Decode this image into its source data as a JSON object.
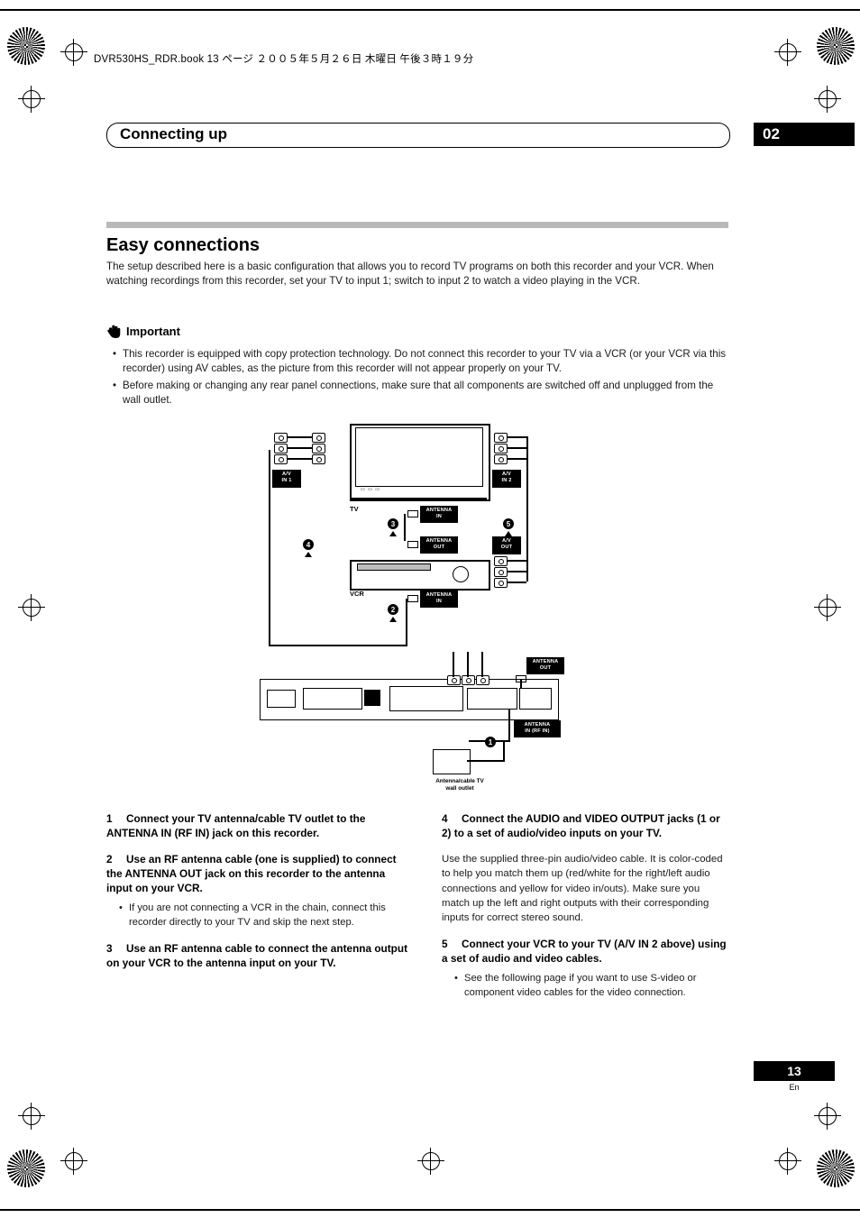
{
  "header": {
    "book_line": "DVR530HS_RDR.book  13 ページ  ２００５年５月２６日   木曜日   午後３時１９分",
    "chapter_title": "Connecting up",
    "chapter_number": "02"
  },
  "section": {
    "title": "Easy connections",
    "intro": "The setup described here is a basic configuration that allows you to record TV programs on both this recorder and your VCR. When watching recordings from this recorder, set your TV to input 1; switch to input 2 to watch a video playing in the VCR.",
    "important_label": "Important",
    "important_bullets": [
      "This recorder is equipped with copy protection technology. Do not connect this recorder to your TV via a VCR (or your VCR via this recorder) using AV cables, as the picture from this recorder will not appear properly on your TV.",
      "Before making or changing any rear panel connections, make sure that all components are switched off and unplugged from the wall outlet."
    ]
  },
  "diagram": {
    "tv_label": "TV",
    "vcr_label": "VCR",
    "av_in_1": "A/V\nIN 1",
    "av_in_2": "A/V\nIN 2",
    "av_out": "A/V\nOUT",
    "antenna_in_tv": "ANTENNA\nIN",
    "antenna_out_tv": "ANTENNA\nOUT",
    "antenna_in_vcr": "ANTENNA\nIN",
    "antenna_out_recorder": "ANTENNA\nOUT",
    "antenna_in_rf": "ANTENNA\nIN (RF IN)",
    "wall_outlet": "Antenna/cable TV\nwall outlet",
    "callouts": [
      "1",
      "2",
      "3",
      "4",
      "5"
    ]
  },
  "steps": {
    "left": [
      {
        "num": "1",
        "title": "Connect your TV antenna/cable TV outlet to the ANTENNA IN (RF IN) jack on this recorder."
      },
      {
        "num": "2",
        "title": "Use an RF antenna cable (one is supplied) to connect the ANTENNA OUT jack on this recorder to the antenna input on your VCR.",
        "bullet": "If you are not connecting a VCR in the chain, connect this recorder directly to your TV and skip the next step."
      },
      {
        "num": "3",
        "title": "Use an RF antenna cable to connect the antenna output on your VCR to the antenna input on your TV."
      }
    ],
    "right": [
      {
        "num": "4",
        "title": "Connect the AUDIO and VIDEO OUTPUT jacks (1 or 2) to a set of audio/video inputs on your TV.",
        "body": "Use the supplied three-pin audio/video cable. It is color-coded to help you match them up (red/white for the right/left audio connections and yellow for video in/outs). Make sure you match up the left and right outputs with their corresponding inputs for correct stereo sound."
      },
      {
        "num": "5",
        "title": "Connect your VCR to your TV (A/V IN 2 above) using a set of audio and video cables.",
        "bullet": "See the following page if you want to use S-video or component video cables for the video connection."
      }
    ]
  },
  "footer": {
    "page_number": "13",
    "language": "En"
  }
}
